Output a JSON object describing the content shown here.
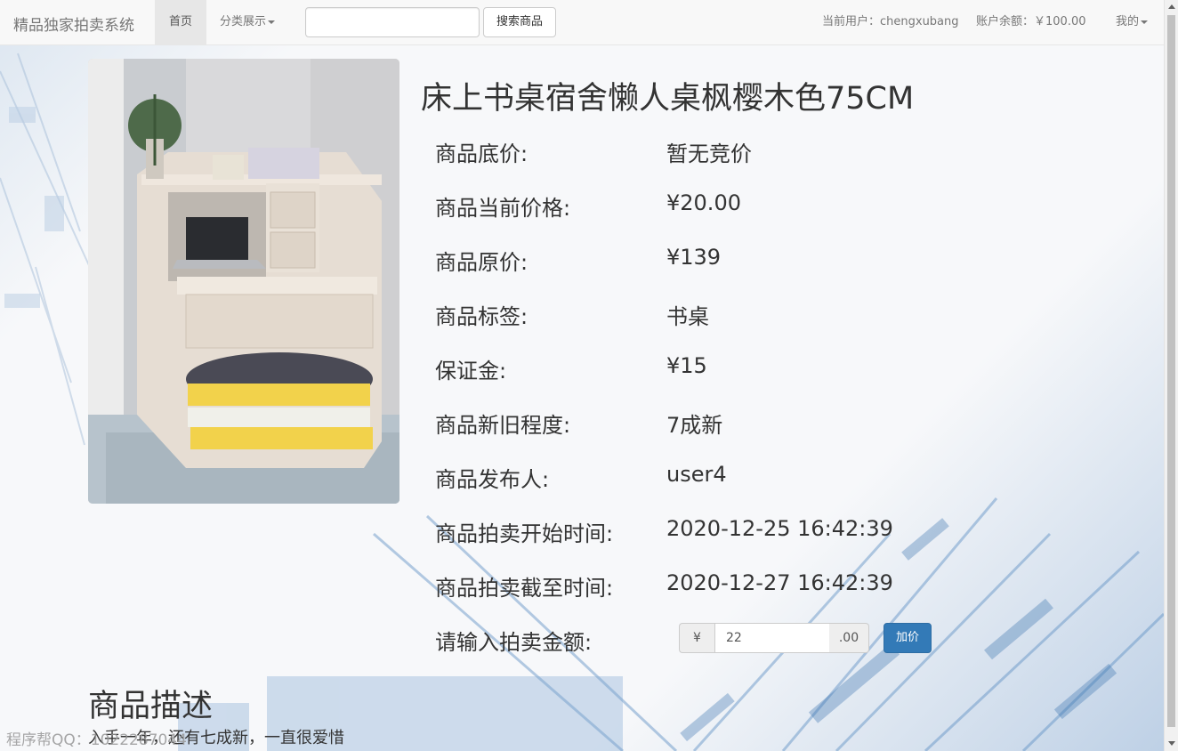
{
  "navbar": {
    "brand": "精品独家拍卖系统",
    "home": "首页",
    "category": "分类展示",
    "search_placeholder": "",
    "search_button": "搜索商品",
    "current_user": "当前用户：chengxubang",
    "balance": "账户余额：￥100.00",
    "mine": "我的"
  },
  "product": {
    "title": "床上书桌宿舍懒人桌枫樱木色75CM",
    "fields": [
      {
        "label": "商品底价:",
        "value": "暂无竞价"
      },
      {
        "label": "商品当前价格:",
        "value": "¥20.00"
      },
      {
        "label": "商品原价:",
        "value": "¥139"
      },
      {
        "label": "商品标签:",
        "value": "书桌"
      },
      {
        "label": "保证金:",
        "value": "¥15"
      },
      {
        "label": "商品新旧程度:",
        "value": "7成新"
      },
      {
        "label": "商品发布人:",
        "value": "user4"
      },
      {
        "label": "商品拍卖开始时间:",
        "value": "2020-12-25 16:42:39"
      },
      {
        "label": "商品拍卖截至时间:",
        "value": "2020-12-27 16:42:39"
      }
    ]
  },
  "bid": {
    "label": "请输入拍卖金额:",
    "currency": "¥",
    "value": "22",
    "suffix": ".00",
    "button": "加价"
  },
  "description": {
    "title": "商品描述",
    "text": "入手一年，还有七成新，一直很爱惜"
  },
  "watermark": "程序帮QQ：1022287044"
}
